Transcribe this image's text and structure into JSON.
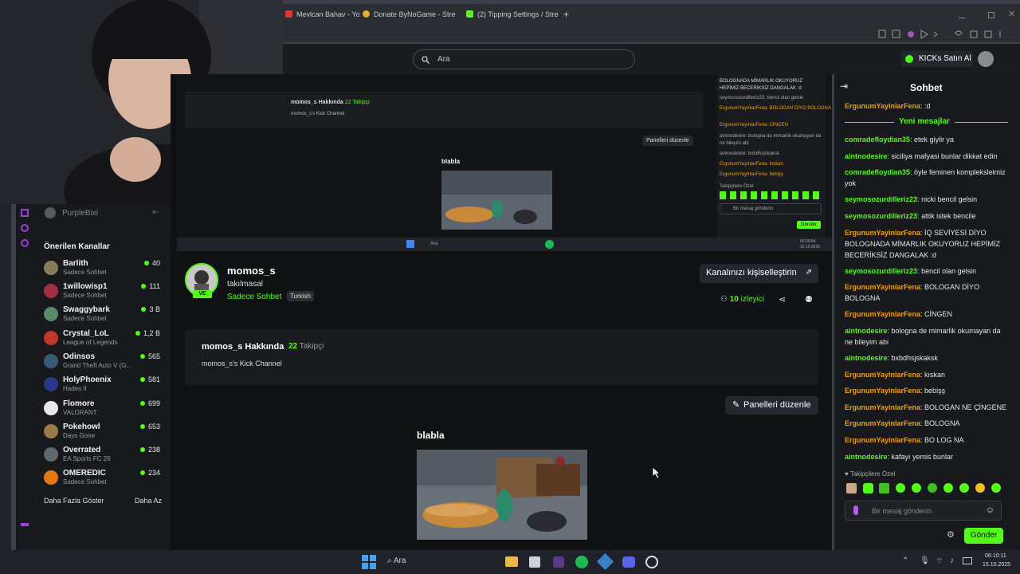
{
  "browser": {
    "tabs": [
      {
        "label": "Mevlcan Bahav - Yo",
        "color": "#e0362d"
      },
      {
        "label": "Donate ByNoGame - Stre",
        "color": "#e1b12c"
      },
      {
        "label": "(2) Tipping Settings / Stre",
        "color": "#53fc18"
      }
    ],
    "new_tab": "+"
  },
  "header": {
    "search_placeholder": "Ara",
    "buy_kicks": "KICKs Satın Al"
  },
  "sidebar": {
    "user": "PurpleBixi",
    "section_title": "Önerilen Kanallar",
    "channels": [
      {
        "name": "Barlith",
        "category": "Sadece Sohbet",
        "viewers": "40",
        "color": "#8a7a5a"
      },
      {
        "name": "1willowisp1",
        "category": "Sadece Sohbet",
        "viewers": "111",
        "color": "#a03040"
      },
      {
        "name": "Swaggybark",
        "category": "Sadece Sohbet",
        "viewers": "3 B",
        "color": "#5a8a6a"
      },
      {
        "name": "Crystal_LoL",
        "category": "League of Legends",
        "viewers": "1,2 B",
        "color": "#c0392b"
      },
      {
        "name": "Odinsos",
        "category": "Grand Theft Auto V (G...",
        "viewers": "565",
        "color": "#3a5a7a"
      },
      {
        "name": "HolyPhoenix",
        "category": "Hades II",
        "viewers": "581",
        "color": "#2a3a8a"
      },
      {
        "name": "Flomore",
        "category": "VALORANT",
        "viewers": "699",
        "color": "#e8e8e8"
      },
      {
        "name": "Pokehowl",
        "category": "Days Gone",
        "viewers": "653",
        "color": "#9a7a4a"
      },
      {
        "name": "Overrated",
        "category": "EA Sports FC 26",
        "viewers": "238",
        "color": "#606870"
      },
      {
        "name": "OMEREDIC",
        "category": "Sadece Sohbet",
        "viewers": "234",
        "color": "#e07a10"
      }
    ],
    "show_more": "Daha Fazla Göster",
    "show_less": "Daha Az"
  },
  "channel": {
    "name": "momos_s",
    "title": "takılmasal",
    "category": "Sadece Sohbet",
    "language": "Turkish",
    "live_badge": "VE",
    "customize": "Kanalınızı kişiselleştirin",
    "viewers": "10",
    "viewers_label": "izleyici",
    "about_title": "momos_s Hakkında",
    "followers": "22",
    "followers_label": "Takipçi",
    "description": "momos_s's Kick Channel",
    "edit_panels": "Panelleri düzenle",
    "panel_title": "blabla"
  },
  "chat": {
    "title": "Sohbet",
    "new_messages": "Yeni mesajlar",
    "messages": [
      {
        "user": "ErgunumYayinlarFena",
        "text": ":d",
        "color": "#f0a000"
      },
      {
        "user": "comradefloydian35",
        "text": "etek giylir ya",
        "color": "#53fc18"
      },
      {
        "user": "aintnodesire",
        "text": "siciliya mafyasi bunlar dikkat edin",
        "color": "#53fc18"
      },
      {
        "user": "comradefloydian35",
        "text": "öyle feminen kompleksleimiz yok",
        "color": "#53fc18"
      },
      {
        "user": "seymosozurdilleriz23",
        "text": "nicki bencil gelsin",
        "color": "#53fc18"
      },
      {
        "user": "seymosozurdilleriz23",
        "text": "attik istek bencile",
        "color": "#53fc18"
      },
      {
        "user": "ErgunumYayinlarFena",
        "text": "İQ SEVİYESİ DİYO BOLOGNADA MİMARLIK OKUYORUZ HEPİMİZ BECERİKSİZ DANGALAK :d",
        "color": "#f0a000"
      },
      {
        "user": "seymosozurdilleriz23",
        "text": "bencil olan gelsin",
        "color": "#53fc18"
      },
      {
        "user": "ErgunumYayinlarFena",
        "text": "BOLOGAN DİYO BOLOGNA",
        "color": "#f0a000"
      },
      {
        "user": "ErgunumYayinlarFena",
        "text": "CİNGEN",
        "color": "#f0a000"
      },
      {
        "user": "aintnodesire",
        "text": "bologna de mimarlik okumayan da ne bileyim abi",
        "color": "#53fc18"
      },
      {
        "user": "aintnodesire",
        "text": "bxbdhsjskaksk",
        "color": "#53fc18"
      },
      {
        "user": "ErgunumYayinlarFena",
        "text": "kıskan",
        "color": "#f0a000"
      },
      {
        "user": "ErgunumYayinlarFena",
        "text": "bebişş",
        "color": "#f0a000"
      },
      {
        "user": "ErgunumYayinlarFena",
        "text": "BOLOGAN NE ÇİNGENE",
        "color": "#f0a000"
      },
      {
        "user": "ErgunumYayinlarFena",
        "text": "BOLOGNA",
        "color": "#f0a000"
      },
      {
        "user": "ErgunumYayinlarFena",
        "text": "BO LOG NA",
        "color": "#f0a000"
      },
      {
        "user": "aintnodesire",
        "text": "kafayı yemis bunlar",
        "color": "#53fc18"
      }
    ],
    "followers_only": "Takipçilere Özel",
    "input_placeholder": "Bir mesaj gönderin",
    "send": "Gönder"
  },
  "nested": {
    "about": "momos_s Hakkında",
    "followers": "22 Takipçi",
    "description": "momos_s's Kick Channel",
    "edit_panels": "Panelleri düzenle",
    "panel_title": "blabla",
    "show_more": "Daha Fazla Göster",
    "show_less": "Daha Az",
    "chat_lines": [
      "BOLOGNADA MİMARLIK OKUYORUZ HEPİMİZ BECERİKSİZ DANGALAK :d",
      "seymosozurdilleriz23: bencil olan gelsin",
      "ErgunumYayinlarFena: BOLOGAN DİYO BOLOGNA",
      "ErgunumYayinlarFena: CİNGEN",
      "aintnodesire: bologna de mimarlik okumayan da ne bileyim abi",
      "aintnodesire: bxbdhsjskaksk",
      "ErgunumYayinlarFena: kıskan",
      "ErgunumYayinlarFena: bebişş"
    ],
    "followers_only": "Takipçilere Özel",
    "input_placeholder": "Bir mesaj gönderin",
    "send": "Gönder",
    "search": "Ara",
    "time": "06:09:54",
    "date": "15.10.2025"
  },
  "taskbar": {
    "search": "Ara",
    "time": "06:10:11",
    "date": "15.10.2025"
  },
  "colors": {
    "kick_green": "#53fc18",
    "background": "#0f1113",
    "chat_bg": "#18191c"
  }
}
